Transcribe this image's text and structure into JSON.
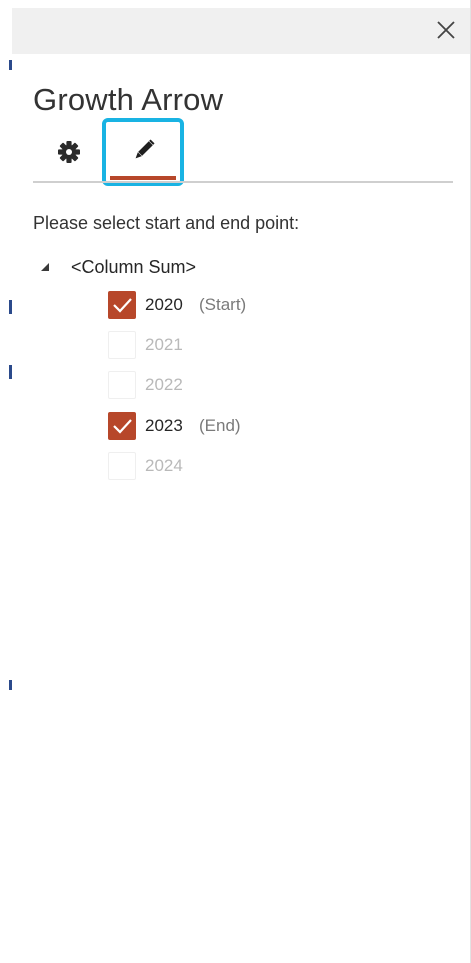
{
  "window": {
    "close_icon": "close-icon"
  },
  "pane": {
    "title": "Growth Arrow"
  },
  "tabs": [
    {
      "name": "settings",
      "icon": "gear-icon",
      "active": false
    },
    {
      "name": "edit",
      "icon": "pencil-icon",
      "active": true
    }
  ],
  "instruction": "Please select start and end point:",
  "tree": {
    "root_label": "<Column Sum>",
    "expanded": true,
    "items": [
      {
        "label": "2020",
        "checked": true,
        "note": "(Start)"
      },
      {
        "label": "2021",
        "checked": false,
        "note": ""
      },
      {
        "label": "2022",
        "checked": false,
        "note": ""
      },
      {
        "label": "2023",
        "checked": true,
        "note": "(End)"
      },
      {
        "label": "2024",
        "checked": false,
        "note": ""
      }
    ]
  },
  "colors": {
    "accent": "#b7472a",
    "highlight": "#19b3e3",
    "title_bar": "#f0f0f0"
  }
}
